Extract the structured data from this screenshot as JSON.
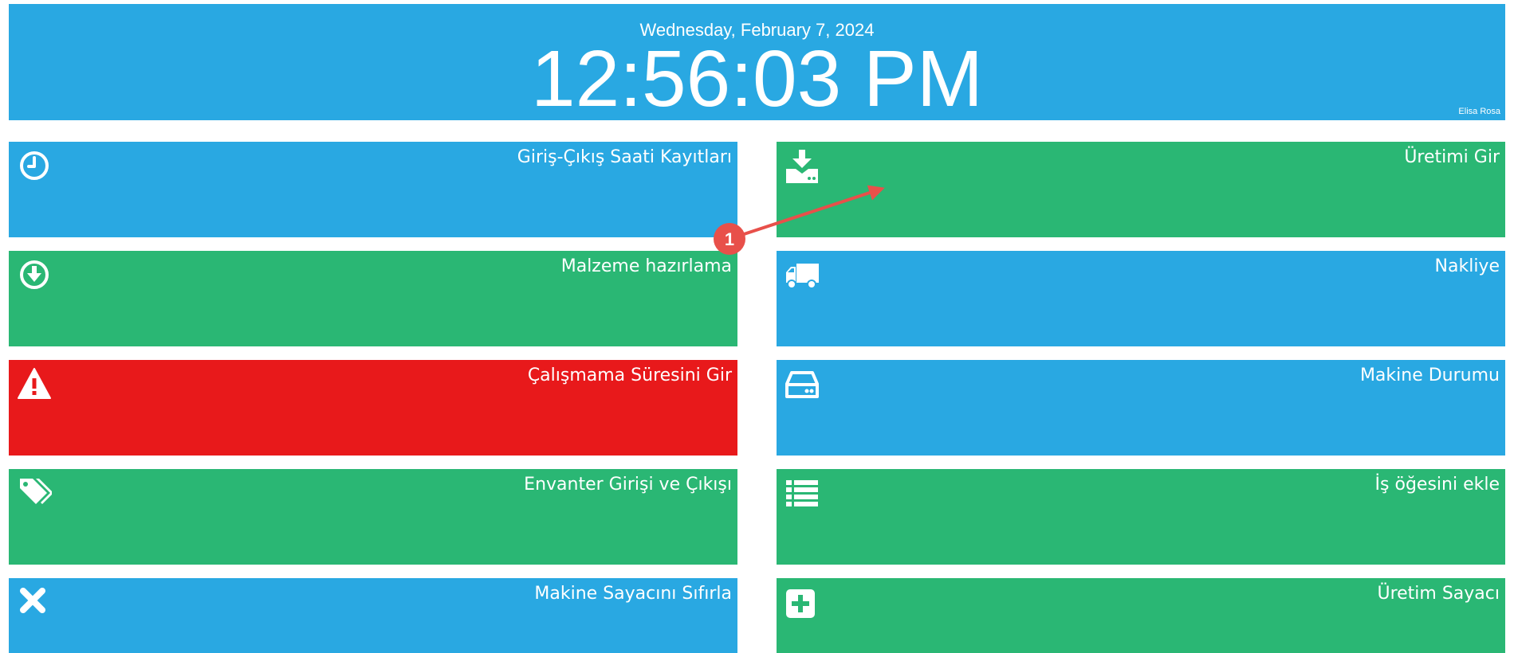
{
  "header": {
    "date": "Wednesday, February 7, 2024",
    "time": "12:56:03 PM",
    "user": "Elisa Rosa"
  },
  "colors": {
    "blue": "#29a8e2",
    "green": "#2ab774",
    "red": "#e8191b",
    "annotation": "#e8504a"
  },
  "tiles": [
    {
      "label": "Giriş-Çıkış Saati Kayıtları",
      "icon": "clock-icon",
      "color": "blue"
    },
    {
      "label": "Üretimi Gir",
      "icon": "download-tray-icon",
      "color": "green"
    },
    {
      "label": "Malzeme hazırlama",
      "icon": "arrow-down-circle-icon",
      "color": "green"
    },
    {
      "label": "Nakliye",
      "icon": "truck-icon",
      "color": "blue"
    },
    {
      "label": "Çalışmama Süresini Gir",
      "icon": "warning-icon",
      "color": "red"
    },
    {
      "label": "Makine Durumu",
      "icon": "hard-drive-icon",
      "color": "blue"
    },
    {
      "label": "Envanter Girişi ve Çıkışı",
      "icon": "tags-icon",
      "color": "green"
    },
    {
      "label": "İş öğesini ekle",
      "icon": "list-icon",
      "color": "green"
    },
    {
      "label": "Makine Sayacını Sıfırla",
      "icon": "x-icon",
      "color": "blue"
    },
    {
      "label": "Üretim Sayacı",
      "icon": "plus-square-icon",
      "color": "green"
    }
  ],
  "annotation": {
    "number": "1"
  }
}
